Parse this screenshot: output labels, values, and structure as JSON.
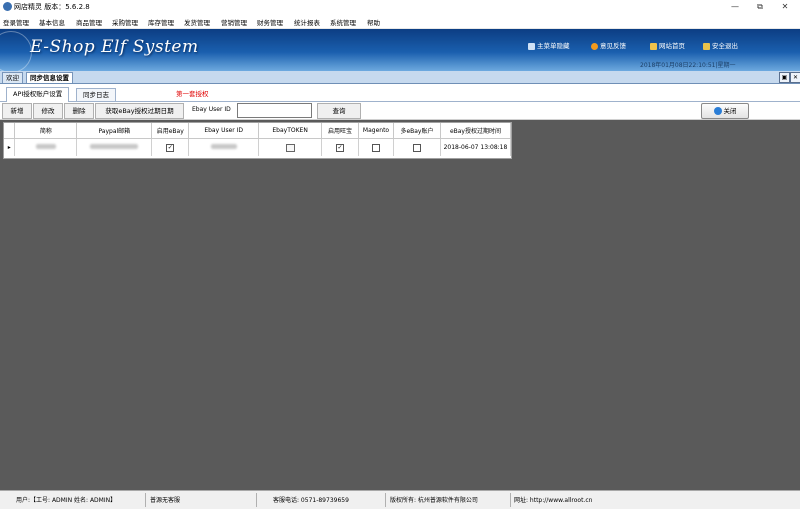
{
  "window": {
    "title": "网店精灵  版本：5.6.2.8",
    "controls": [
      "—",
      "⧉",
      "✕"
    ]
  },
  "menu": [
    "登录管理",
    "基本信息",
    "商品管理",
    "采购管理",
    "库存管理",
    "发货管理",
    "营销管理",
    "财务管理",
    "统计报表",
    "系统管理",
    "帮助"
  ],
  "header": {
    "logo": "E-Shop Elf System",
    "links": {
      "hide_menu": "主菜单隐藏",
      "feedback": "意见反馈",
      "home": "网站首页",
      "logout": "安全退出"
    },
    "datetime": "2018年01月08日22:10:51|星期一"
  },
  "outer_tabs": [
    "欢迎",
    "同步信息设置"
  ],
  "inner_tabs": [
    "API授权账户设置",
    "同步日志"
  ],
  "page_title": "第一套授权",
  "toolbar": {
    "add": "新增",
    "edit": "修改",
    "delete": "删除",
    "fetch_expiry": "获取eBay授权过期日期",
    "ebay_user_id_label": "Ebay User ID",
    "ebay_user_id_value": "",
    "query": "查询",
    "close": "关闭"
  },
  "grid": {
    "columns": [
      "简称",
      "Paypal邮箱",
      "启用eBay",
      "Ebay User ID",
      "EbayTOKEN",
      "启用旺宝",
      "Magento",
      "多eBay账户",
      "eBay授权过期时间"
    ],
    "rows": [
      {
        "enable_ebay": true,
        "enable_wangbao": true,
        "magento": false,
        "multi_ebay": false,
        "expiry": "2018-06-07 13:08:18"
      }
    ]
  },
  "status": {
    "user": "用户:【工号: ADMIN  姓名: ADMIN】",
    "company": "普源无客服",
    "phone": "客服电话: 0571-89739659",
    "copyright": "版权所有: 杭州普源软件有限公司",
    "website": "网址: http://www.allroot.cn"
  },
  "colors": {
    "banner_dark": "#0c3d83",
    "banner_light": "#6da9df",
    "accent_red": "#e00000",
    "workspace": "#5a5a5a"
  }
}
